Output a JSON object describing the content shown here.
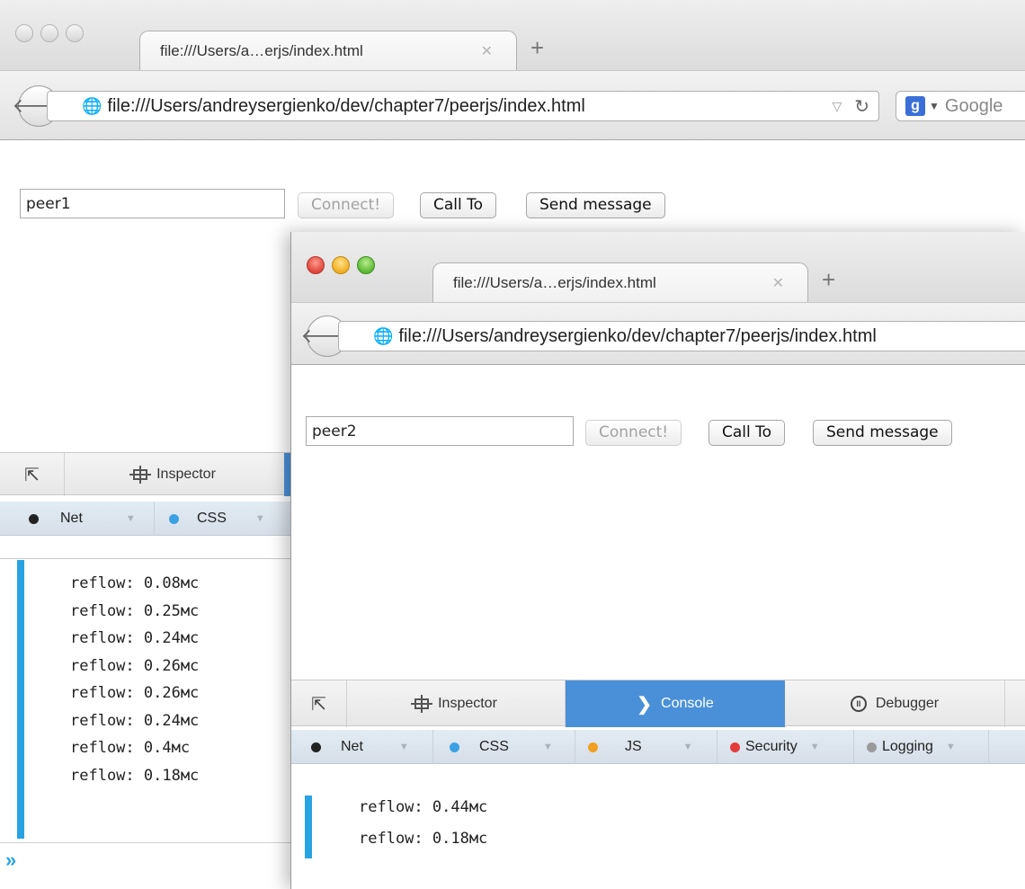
{
  "back_window": {
    "tab_title": "file:///Users/a…erjs/index.html",
    "tab_close": "✕",
    "new_tab": "+",
    "url": "file:///Users/andreysergienko/dev/chapter7/peerjs/index.html",
    "search_placeholder": "Google",
    "peer_input_value": "peer1",
    "buttons": {
      "connect": "Connect!",
      "call_to": "Call To",
      "send_message": "Send message"
    },
    "devtools": {
      "tabs": {
        "inspector": "Inspector"
      },
      "filters": {
        "net": "Net",
        "css": "CSS"
      },
      "console_lines": [
        "reflow: 0.08мс",
        "reflow: 0.25мс",
        "reflow: 0.24мс",
        "reflow: 0.26мс",
        "reflow: 0.26мс",
        "reflow: 0.24мс",
        "reflow: 0.4мс",
        "reflow: 0.18мс"
      ],
      "prompt": "»"
    }
  },
  "front_window": {
    "tab_title": "file:///Users/a…erjs/index.html",
    "tab_close": "✕",
    "new_tab": "+",
    "url": "file:///Users/andreysergienko/dev/chapter7/peerjs/index.html",
    "peer_input_value": "peer2",
    "buttons": {
      "connect": "Connect!",
      "call_to": "Call To",
      "send_message": "Send message"
    },
    "devtools": {
      "tabs": {
        "inspector": "Inspector",
        "console": "Console",
        "debugger": "Debugger"
      },
      "filters": {
        "net": "Net",
        "css": "CSS",
        "js": "JS",
        "security": "Security",
        "logging": "Logging"
      },
      "console_lines": [
        "reflow: 0.44мс",
        "reflow: 0.18мс"
      ]
    }
  },
  "colors": {
    "devtools_active_tab": "#4a90d9",
    "console_bar": "#27a3e2",
    "net_dot": "#222222",
    "css_dot": "#3aa2e4",
    "js_dot": "#f0a020",
    "security_dot": "#e33b3b",
    "logging_dot": "#9a9a9a"
  }
}
